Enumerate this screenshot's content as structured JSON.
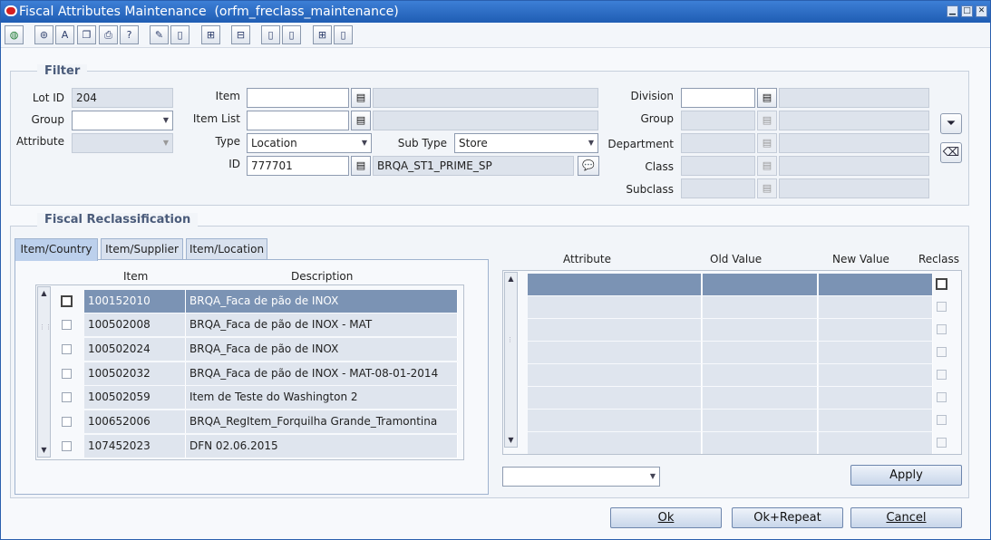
{
  "window": {
    "title": "Fiscal Attributes Maintenance  (orfm_freclass_maintenance)",
    "controls": [
      "minimize-icon",
      "maximize-icon",
      "close-icon"
    ]
  },
  "toolbar": {
    "icons": [
      "globe-icon",
      "save-icon",
      "spellcheck-icon",
      "copy-icon",
      "print-icon",
      "help-icon",
      "edit-icon",
      "new-doc-icon",
      "tree-icon",
      "tree-alt-icon",
      "doc-icon",
      "doc-alt-icon",
      "tree-doc-icon",
      "doc-new-icon"
    ]
  },
  "filter": {
    "legend": "Filter",
    "lot_id_label": "Lot ID",
    "lot_id_value": "204",
    "group_label": "Group",
    "group_value": "",
    "attribute_label": "Attribute",
    "attribute_value": "",
    "item_label": "Item",
    "item_value": "",
    "item_desc": "",
    "item_list_label": "Item List",
    "item_list_value": "",
    "item_list_desc": "",
    "type_label": "Type",
    "type_value": "Location",
    "sub_type_label": "Sub Type",
    "sub_type_value": "Store",
    "id_label": "ID",
    "id_value": "777701",
    "id_desc": "BRQA_ST1_PRIME_SP",
    "division_label": "Division",
    "merch_group_label": "Group",
    "department_label": "Department",
    "class_label": "Class",
    "subclass_label": "Subclass"
  },
  "reclass": {
    "legend": "Fiscal Reclassification",
    "tabs": [
      "Item/Country",
      "Item/Supplier",
      "Item/Location"
    ],
    "active_tab": "Item/Country",
    "item_header": "Item",
    "description_header": "Description",
    "items": [
      {
        "item": "100152010",
        "description": "BRQA_Faca de pão de INOX",
        "selected": true
      },
      {
        "item": "100502008",
        "description": "BRQA_Faca de pão de INOX - MAT",
        "selected": false
      },
      {
        "item": "100502024",
        "description": "BRQA_Faca de pão de INOX",
        "selected": false
      },
      {
        "item": "100502032",
        "description": "BRQA_Faca de pão de INOX - MAT-08-01-2014",
        "selected": false
      },
      {
        "item": "100502059",
        "description": "Item de Teste do Washington 2",
        "selected": false
      },
      {
        "item": "100652006",
        "description": "BRQA_RegItem_Forquilha Grande_Tramontina",
        "selected": false
      },
      {
        "item": "107452023",
        "description": "DFN 02.06.2015",
        "selected": false
      }
    ],
    "attr_headers": {
      "attribute": "Attribute",
      "old_value": "Old Value",
      "new_value": "New Value",
      "reclass": "Reclass"
    },
    "attr_row_count": 8,
    "bottom_select_value": "",
    "apply_label": "Apply"
  },
  "footer": {
    "ok_label": "Ok",
    "ok_repeat_label": "Ok+Repeat",
    "cancel_label": "Cancel"
  }
}
